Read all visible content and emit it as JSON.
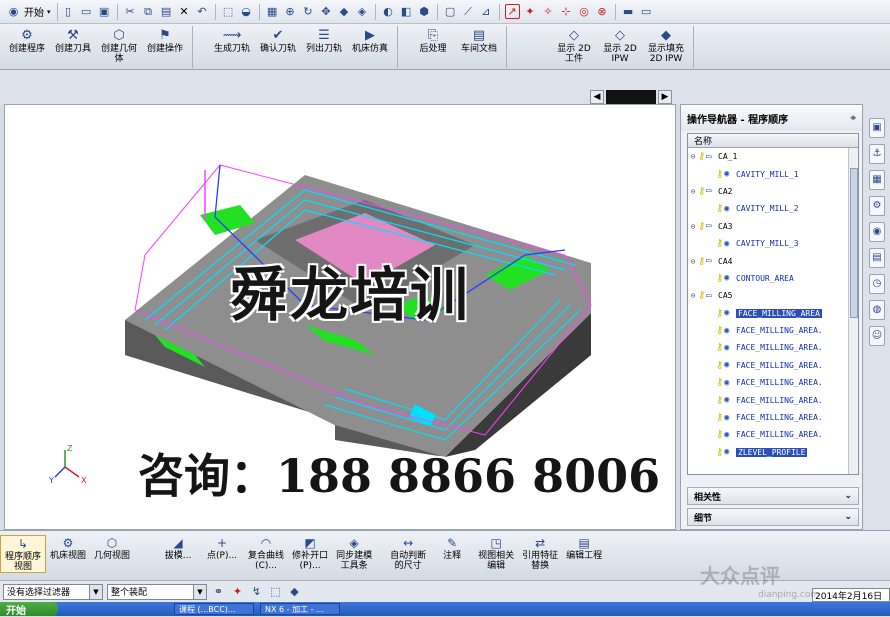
{
  "toolbar": {
    "start_label": "开始",
    "icons": [
      "new-icon",
      "open-icon",
      "save-icon",
      "cut-icon",
      "copy-icon",
      "paste-icon",
      "delete-icon",
      "undo-icon",
      "select-icon",
      "view-icon",
      "fit-icon",
      "zoom-icon",
      "rotate-icon",
      "pan-icon",
      "shade-icon",
      "orient-icon",
      "render-icon",
      "layer-icon",
      "wcs-icon",
      "snap-icon",
      "measure-icon",
      "analysis-icon"
    ]
  },
  "ribbon": {
    "groups": [
      {
        "buttons": [
          "创建程序",
          "创建刀具",
          "创建几何\n体",
          "创建操作"
        ]
      },
      {
        "buttons": [
          "生成刀轨",
          "确认刀轨",
          "列出刀轨",
          "机床仿真"
        ]
      },
      {
        "buttons": [
          "后处理",
          "车间文档"
        ]
      },
      {
        "buttons": [
          "显示 2D\n工件",
          "显示 2D\nIPW",
          "显示填充\n2D IPW"
        ]
      }
    ]
  },
  "viewport": {
    "watermark_title": "舜龙培训",
    "watermark_contact": "咨询：188  8866  8006",
    "triad_labels": [
      "Z",
      "Y",
      "X"
    ]
  },
  "navigator": {
    "title": "操作导航器 - 程序顺序",
    "column_name": "名称",
    "nodes": [
      {
        "label": "CA_1",
        "kind": "group"
      },
      {
        "label": "CAVITY_MILL_1",
        "kind": "op"
      },
      {
        "label": "CA2",
        "kind": "group"
      },
      {
        "label": "CAVITY_MILL_2",
        "kind": "op"
      },
      {
        "label": "CA3",
        "kind": "group"
      },
      {
        "label": "CAVITY_MILL_3",
        "kind": "op"
      },
      {
        "label": "CA4",
        "kind": "group"
      },
      {
        "label": "CONTOUR_AREA",
        "kind": "op"
      },
      {
        "label": "CA5",
        "kind": "group"
      },
      {
        "label": "FACE_MILLING_AREA",
        "kind": "op",
        "selected": true
      },
      {
        "label": "FACE_MILLING_AREA.",
        "kind": "op2"
      },
      {
        "label": "FACE_MILLING_AREA.",
        "kind": "op2"
      },
      {
        "label": "FACE_MILLING_AREA.",
        "kind": "op2"
      },
      {
        "label": "FACE_MILLING_AREA.",
        "kind": "op2"
      },
      {
        "label": "FACE_MILLING_AREA.",
        "kind": "op2"
      },
      {
        "label": "FACE_MILLING_AREA.",
        "kind": "op2"
      },
      {
        "label": "FACE_MILLING_AREA.",
        "kind": "op2"
      },
      {
        "label": "ZLEVEL_PROFILE",
        "kind": "op",
        "selected": true
      }
    ],
    "section_related": "相关性",
    "section_details": "细节"
  },
  "bottombar": {
    "buttons": [
      "程序顺序\n视图",
      "机床视图",
      "几何视图",
      "拔模...",
      "点(P)...",
      "复合曲线\n(C)...",
      "修补开口\n(P)...",
      "同步建模\n工具条",
      "自动判断\n的尺寸",
      "注释",
      "视图相关\n编辑",
      "引用特征\n替换",
      "编辑工程"
    ]
  },
  "filterbar": {
    "filter_value": "没有选择过滤器",
    "assembly_value": "整个装配"
  },
  "taskbar": {
    "start_label": "开始",
    "tasks": [
      "课程 (...BCC)...",
      "NX 6 - 加工 - ..."
    ]
  },
  "statusbar": {
    "date": "2014年2月16日"
  },
  "site_watermark": {
    "logo": "大众点评",
    "url": "dianping.com"
  },
  "colors": {
    "part_gray": "#8e8e8e",
    "part_dark": "#4a4a4a",
    "face_green": "#22e022",
    "toolpath_cyan": "#00e0ff",
    "toolpath_magenta": "#ff40ff",
    "toolpath_blue": "#2040ff",
    "selection_blue": "#2a4fb8"
  }
}
